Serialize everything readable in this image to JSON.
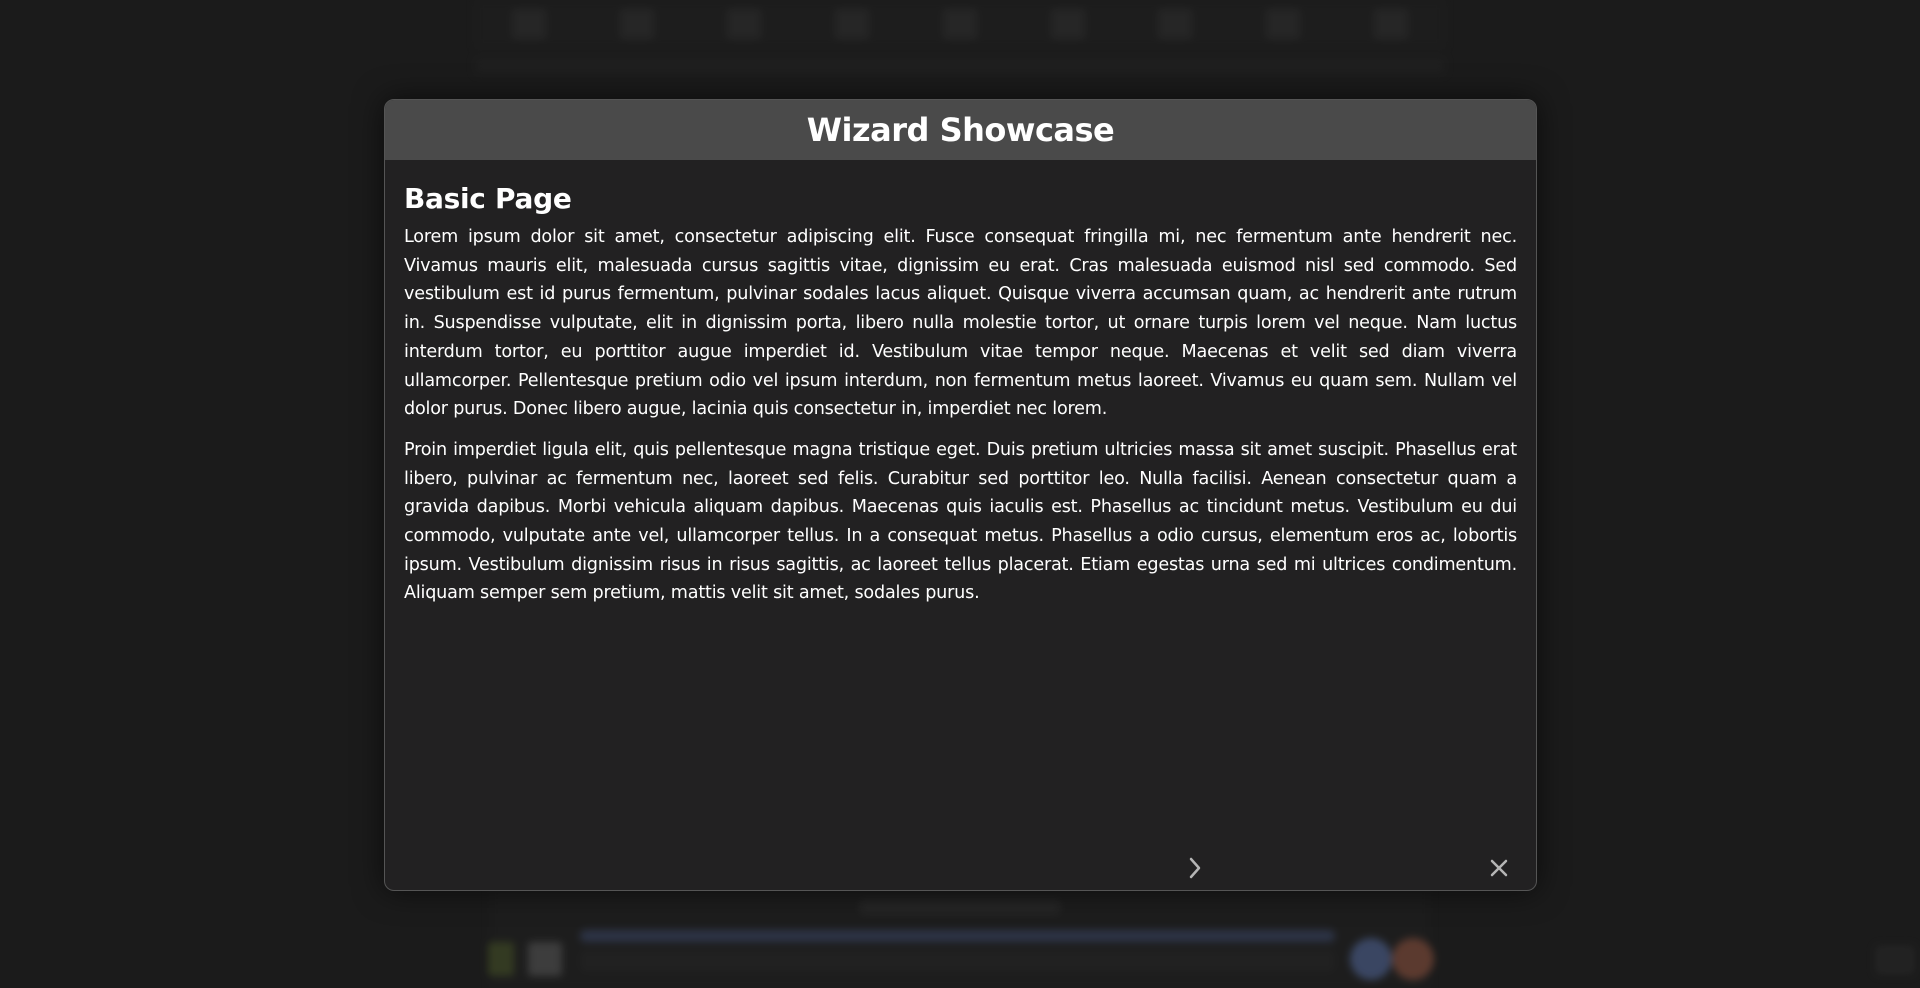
{
  "dialog": {
    "title": "Wizard Showcase",
    "page_heading": "Basic Page",
    "paragraphs": [
      "Lorem ipsum dolor sit amet, consectetur adipiscing elit. Fusce consequat fringilla mi, nec fermentum ante hendrerit nec. Vivamus mauris elit, malesuada cursus sagittis vitae, dignissim eu erat. Cras malesuada euismod nisl sed commodo. Sed vestibulum est id purus fermentum, pulvinar sodales lacus aliquet. Quisque viverra accumsan quam, ac hendrerit ante rutrum in. Suspendisse vulputate, elit in dignissim porta, libero nulla molestie tortor, ut ornare turpis lorem vel neque. Nam luctus interdum tortor, eu porttitor augue imperdiet id. Vestibulum vitae tempor neque. Maecenas et velit sed diam viverra ullamcorper. Pellentesque pretium odio vel ipsum interdum, non fermentum metus laoreet. Vivamus eu quam sem. Nullam vel dolor purus. Donec libero augue, lacinia quis consectetur in, imperdiet nec lorem.",
      "Proin imperdiet ligula elit, quis pellentesque magna tristique eget. Duis pretium ultricies massa sit amet suscipit. Phasellus erat libero, pulvinar ac fermentum nec, laoreet sed felis. Curabitur sed porttitor leo. Nulla facilisi. Aenean consectetur quam a gravida dapibus. Morbi vehicula aliquam dapibus. Maecenas quis iaculis est. Phasellus ac tincidunt metus. Vestibulum eu dui commodo, vulputate ante vel, ullamcorper tellus. In a consequat metus. Phasellus a odio cursus, elementum eros ac, lobortis ipsum. Vestibulum dignissim risus in risus sagittis, ac laoreet tellus placerat. Etiam egestas urna sed mi ultrices condimentum. Aliquam semper sem pretium, mattis velit sit amet, sodales purus."
    ],
    "footer": {
      "step_indicator_icon": "dot-icon",
      "next_icon": "chevron-right-icon",
      "close_icon": "close-icon"
    }
  },
  "colors": {
    "header_bg": "#4a4a4a",
    "dialog_bg": "#222122",
    "page_bg": "#202020",
    "text": "#ffffff",
    "icon": "#b5b5b5"
  }
}
